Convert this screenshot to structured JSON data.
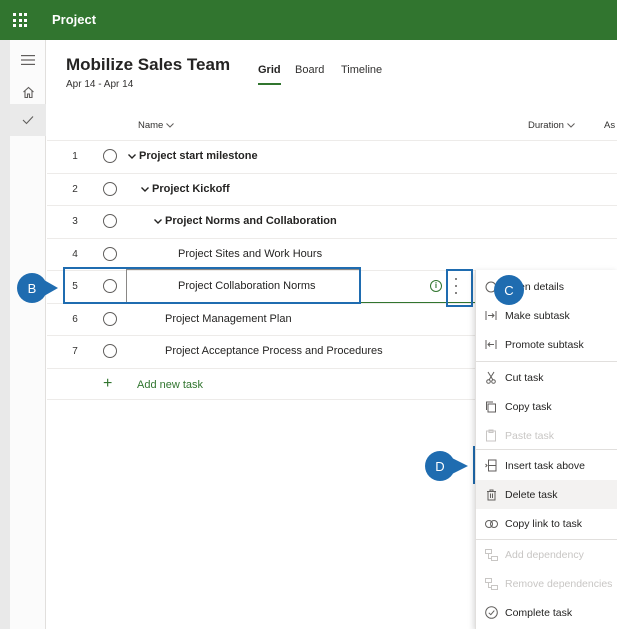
{
  "app": {
    "title": "Project"
  },
  "plan": {
    "title": "Mobilize Sales Team",
    "dates": "Apr 14 - Apr 14"
  },
  "views": [
    {
      "label": "Grid",
      "selected": true
    },
    {
      "label": "Board",
      "selected": false
    },
    {
      "label": "Timeline",
      "selected": false
    }
  ],
  "columns": {
    "name": "Name",
    "duration": "Duration",
    "assigned": "As"
  },
  "rows": [
    {
      "num": "1",
      "title": "Project start milestone",
      "bold": true,
      "caret": true
    },
    {
      "num": "2",
      "title": "Project Kickoff",
      "bold": true,
      "caret": true
    },
    {
      "num": "3",
      "title": "Project Norms and Collaboration",
      "bold": true,
      "caret": true
    },
    {
      "num": "4",
      "title": "Project Sites and Work Hours",
      "bold": false,
      "caret": false
    },
    {
      "num": "5",
      "title": "Project Collaboration Norms",
      "bold": false,
      "caret": false
    },
    {
      "num": "6",
      "title": "Project Management Plan",
      "bold": false,
      "caret": false
    },
    {
      "num": "7",
      "title": "Project Acceptance Process and Procedures",
      "bold": false,
      "caret": false
    }
  ],
  "add_task": {
    "label": "Add new task"
  },
  "callouts": {
    "b": "B",
    "c": "C",
    "d": "D"
  },
  "menu": {
    "items": [
      {
        "label": "Open details",
        "icon": "info-icon",
        "disabled": false
      },
      {
        "label": "Make subtask",
        "icon": "indent-icon",
        "disabled": false
      },
      {
        "label": "Promote subtask",
        "icon": "outdent-icon",
        "disabled": false
      },
      {
        "label": "Cut task",
        "icon": "scissors-icon",
        "disabled": false
      },
      {
        "label": "Copy task",
        "icon": "copy-icon",
        "disabled": false
      },
      {
        "label": "Paste task",
        "icon": "paste-icon",
        "disabled": true
      },
      {
        "label": "Insert task above",
        "icon": "insert-above-icon",
        "disabled": false
      },
      {
        "label": "Delete task",
        "icon": "trash-icon",
        "disabled": false
      },
      {
        "label": "Copy link to task",
        "icon": "link-icon",
        "disabled": false
      },
      {
        "label": "Add dependency",
        "icon": "dependency-icon",
        "disabled": true
      },
      {
        "label": "Remove dependencies",
        "icon": "dependency-icon",
        "disabled": true
      },
      {
        "label": "Complete task",
        "icon": "check-circle-icon",
        "disabled": false
      }
    ]
  },
  "colors": {
    "brand": "#31752f",
    "callout": "#1f6cb0"
  }
}
